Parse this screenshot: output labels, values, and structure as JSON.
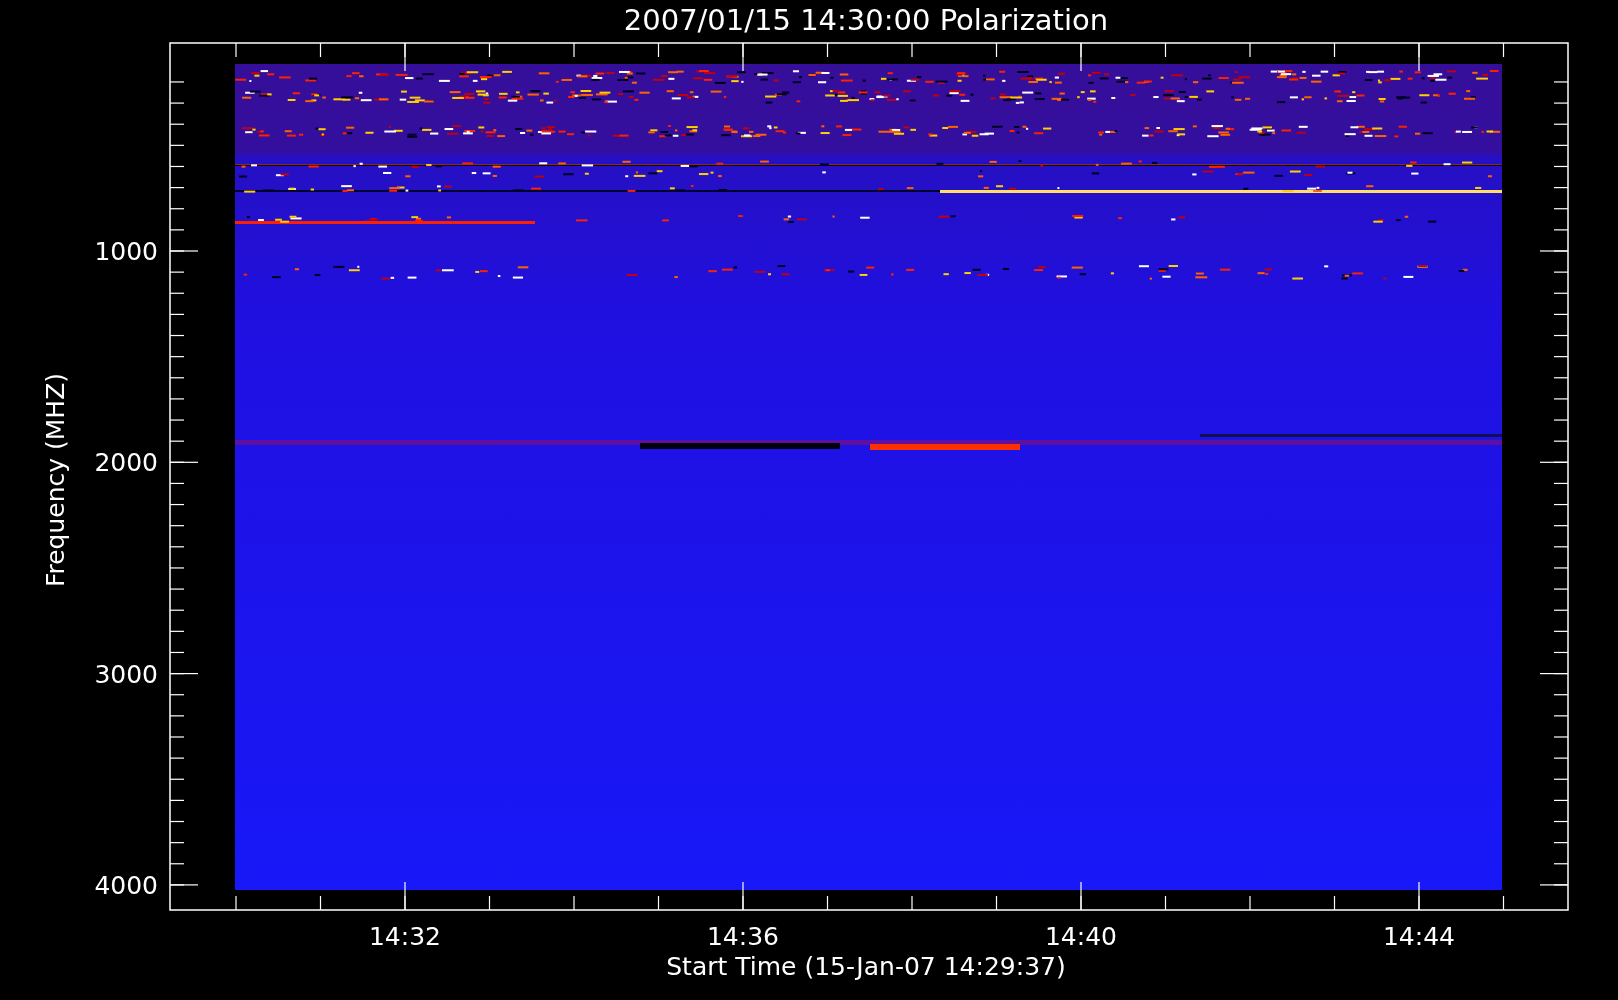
{
  "title": "2007/01/15 14:30:00 Polarization",
  "y_axis": {
    "label": "Frequency (MHZ)",
    "ticks": [
      "1000",
      "2000",
      "3000",
      "4000"
    ]
  },
  "x_axis": {
    "label": "Start Time (15-Jan-07 14:29:37)",
    "ticks": [
      "14:32",
      "14:36",
      "14:40",
      "14:44"
    ]
  }
}
